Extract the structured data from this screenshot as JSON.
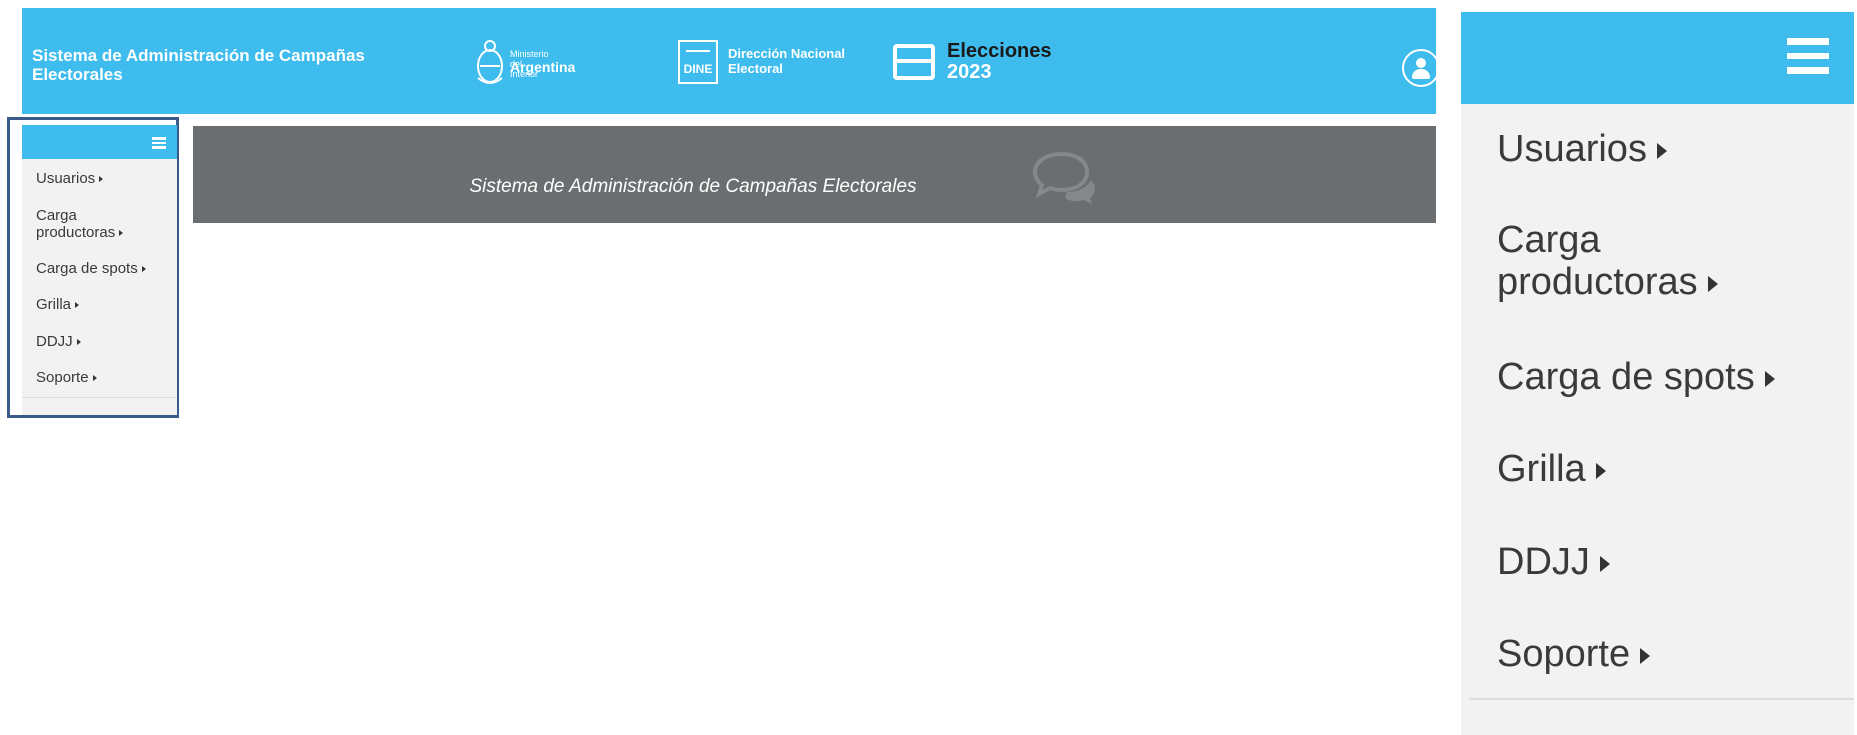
{
  "header": {
    "app_title": "Sistema de Administración de Campañas\nElectorales",
    "ministry_line1": "Ministerio del Interior",
    "ministry_line2": "Argentina",
    "dine_badge": "DINE",
    "dine_text": "Dirección Nacional\nElectoral",
    "elections_title": "Elecciones",
    "elections_year": "2023",
    "user_icon": "user-circle-icon",
    "accent_color": "#3dbced"
  },
  "menu": {
    "items": [
      {
        "label": "Usuarios"
      },
      {
        "label": "Carga\nproductoras"
      },
      {
        "label": "Carga de spots"
      },
      {
        "label": "Grilla"
      },
      {
        "label": "DDJJ"
      },
      {
        "label": "Soporte"
      }
    ],
    "toggle_icon": "hamburger-icon"
  },
  "banner": {
    "text": "Sistema de Administración de Campañas Electorales",
    "icon": "chat-bubbles-icon",
    "background": "#6b6e70"
  }
}
